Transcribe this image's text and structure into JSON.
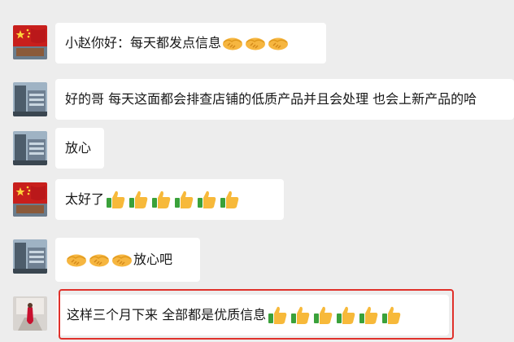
{
  "messages": [
    {
      "sender": "flag",
      "text": "小赵你好：每天都发点信息",
      "emoji": [
        "handshake",
        "handshake",
        "handshake"
      ],
      "emoji_after": true
    },
    {
      "sender": "building",
      "text": "好的哥 每天这面都会排查店铺的低质产品并且会处理  也会上新产品的哈",
      "emoji": [],
      "emoji_after": true
    },
    {
      "sender": "building",
      "text": "放心",
      "emoji": [],
      "emoji_after": true
    },
    {
      "sender": "flag",
      "text": "太好了",
      "emoji": [
        "thumbs-up",
        "thumbs-up",
        "thumbs-up",
        "thumbs-up",
        "thumbs-up",
        "thumbs-up"
      ],
      "emoji_after": true
    },
    {
      "sender": "building",
      "text": "放心吧",
      "emoji": [
        "handshake",
        "handshake",
        "handshake"
      ],
      "emoji_after": false
    },
    {
      "sender": "bride",
      "text": "这样三个月下来  全部都是优质信息",
      "emoji": [
        "thumbs-up",
        "thumbs-up",
        "thumbs-up",
        "thumbs-up",
        "thumbs-up",
        "thumbs-up"
      ],
      "emoji_after": true
    }
  ],
  "colors": {
    "background": "#ededed",
    "bubble": "#ffffff",
    "text": "#181818",
    "highlight_border": "#e0312b"
  },
  "highlighted_message": 5
}
